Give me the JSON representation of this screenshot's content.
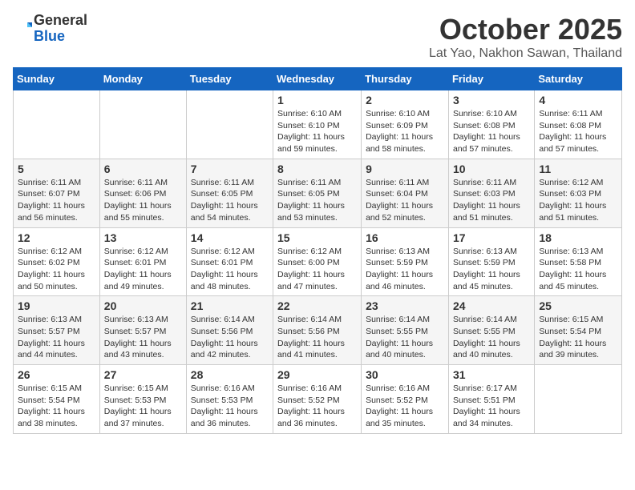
{
  "header": {
    "logo_general": "General",
    "logo_blue": "Blue",
    "month_title": "October 2025",
    "location": "Lat Yao, Nakhon Sawan, Thailand"
  },
  "weekdays": [
    "Sunday",
    "Monday",
    "Tuesday",
    "Wednesday",
    "Thursday",
    "Friday",
    "Saturday"
  ],
  "weeks": [
    [
      {
        "day": "",
        "info": ""
      },
      {
        "day": "",
        "info": ""
      },
      {
        "day": "",
        "info": ""
      },
      {
        "day": "1",
        "info": "Sunrise: 6:10 AM\nSunset: 6:10 PM\nDaylight: 11 hours\nand 59 minutes."
      },
      {
        "day": "2",
        "info": "Sunrise: 6:10 AM\nSunset: 6:09 PM\nDaylight: 11 hours\nand 58 minutes."
      },
      {
        "day": "3",
        "info": "Sunrise: 6:10 AM\nSunset: 6:08 PM\nDaylight: 11 hours\nand 57 minutes."
      },
      {
        "day": "4",
        "info": "Sunrise: 6:11 AM\nSunset: 6:08 PM\nDaylight: 11 hours\nand 57 minutes."
      }
    ],
    [
      {
        "day": "5",
        "info": "Sunrise: 6:11 AM\nSunset: 6:07 PM\nDaylight: 11 hours\nand 56 minutes."
      },
      {
        "day": "6",
        "info": "Sunrise: 6:11 AM\nSunset: 6:06 PM\nDaylight: 11 hours\nand 55 minutes."
      },
      {
        "day": "7",
        "info": "Sunrise: 6:11 AM\nSunset: 6:05 PM\nDaylight: 11 hours\nand 54 minutes."
      },
      {
        "day": "8",
        "info": "Sunrise: 6:11 AM\nSunset: 6:05 PM\nDaylight: 11 hours\nand 53 minutes."
      },
      {
        "day": "9",
        "info": "Sunrise: 6:11 AM\nSunset: 6:04 PM\nDaylight: 11 hours\nand 52 minutes."
      },
      {
        "day": "10",
        "info": "Sunrise: 6:11 AM\nSunset: 6:03 PM\nDaylight: 11 hours\nand 51 minutes."
      },
      {
        "day": "11",
        "info": "Sunrise: 6:12 AM\nSunset: 6:03 PM\nDaylight: 11 hours\nand 51 minutes."
      }
    ],
    [
      {
        "day": "12",
        "info": "Sunrise: 6:12 AM\nSunset: 6:02 PM\nDaylight: 11 hours\nand 50 minutes."
      },
      {
        "day": "13",
        "info": "Sunrise: 6:12 AM\nSunset: 6:01 PM\nDaylight: 11 hours\nand 49 minutes."
      },
      {
        "day": "14",
        "info": "Sunrise: 6:12 AM\nSunset: 6:01 PM\nDaylight: 11 hours\nand 48 minutes."
      },
      {
        "day": "15",
        "info": "Sunrise: 6:12 AM\nSunset: 6:00 PM\nDaylight: 11 hours\nand 47 minutes."
      },
      {
        "day": "16",
        "info": "Sunrise: 6:13 AM\nSunset: 5:59 PM\nDaylight: 11 hours\nand 46 minutes."
      },
      {
        "day": "17",
        "info": "Sunrise: 6:13 AM\nSunset: 5:59 PM\nDaylight: 11 hours\nand 45 minutes."
      },
      {
        "day": "18",
        "info": "Sunrise: 6:13 AM\nSunset: 5:58 PM\nDaylight: 11 hours\nand 45 minutes."
      }
    ],
    [
      {
        "day": "19",
        "info": "Sunrise: 6:13 AM\nSunset: 5:57 PM\nDaylight: 11 hours\nand 44 minutes."
      },
      {
        "day": "20",
        "info": "Sunrise: 6:13 AM\nSunset: 5:57 PM\nDaylight: 11 hours\nand 43 minutes."
      },
      {
        "day": "21",
        "info": "Sunrise: 6:14 AM\nSunset: 5:56 PM\nDaylight: 11 hours\nand 42 minutes."
      },
      {
        "day": "22",
        "info": "Sunrise: 6:14 AM\nSunset: 5:56 PM\nDaylight: 11 hours\nand 41 minutes."
      },
      {
        "day": "23",
        "info": "Sunrise: 6:14 AM\nSunset: 5:55 PM\nDaylight: 11 hours\nand 40 minutes."
      },
      {
        "day": "24",
        "info": "Sunrise: 6:14 AM\nSunset: 5:55 PM\nDaylight: 11 hours\nand 40 minutes."
      },
      {
        "day": "25",
        "info": "Sunrise: 6:15 AM\nSunset: 5:54 PM\nDaylight: 11 hours\nand 39 minutes."
      }
    ],
    [
      {
        "day": "26",
        "info": "Sunrise: 6:15 AM\nSunset: 5:54 PM\nDaylight: 11 hours\nand 38 minutes."
      },
      {
        "day": "27",
        "info": "Sunrise: 6:15 AM\nSunset: 5:53 PM\nDaylight: 11 hours\nand 37 minutes."
      },
      {
        "day": "28",
        "info": "Sunrise: 6:16 AM\nSunset: 5:53 PM\nDaylight: 11 hours\nand 36 minutes."
      },
      {
        "day": "29",
        "info": "Sunrise: 6:16 AM\nSunset: 5:52 PM\nDaylight: 11 hours\nand 36 minutes."
      },
      {
        "day": "30",
        "info": "Sunrise: 6:16 AM\nSunset: 5:52 PM\nDaylight: 11 hours\nand 35 minutes."
      },
      {
        "day": "31",
        "info": "Sunrise: 6:17 AM\nSunset: 5:51 PM\nDaylight: 11 hours\nand 34 minutes."
      },
      {
        "day": "",
        "info": ""
      }
    ]
  ]
}
